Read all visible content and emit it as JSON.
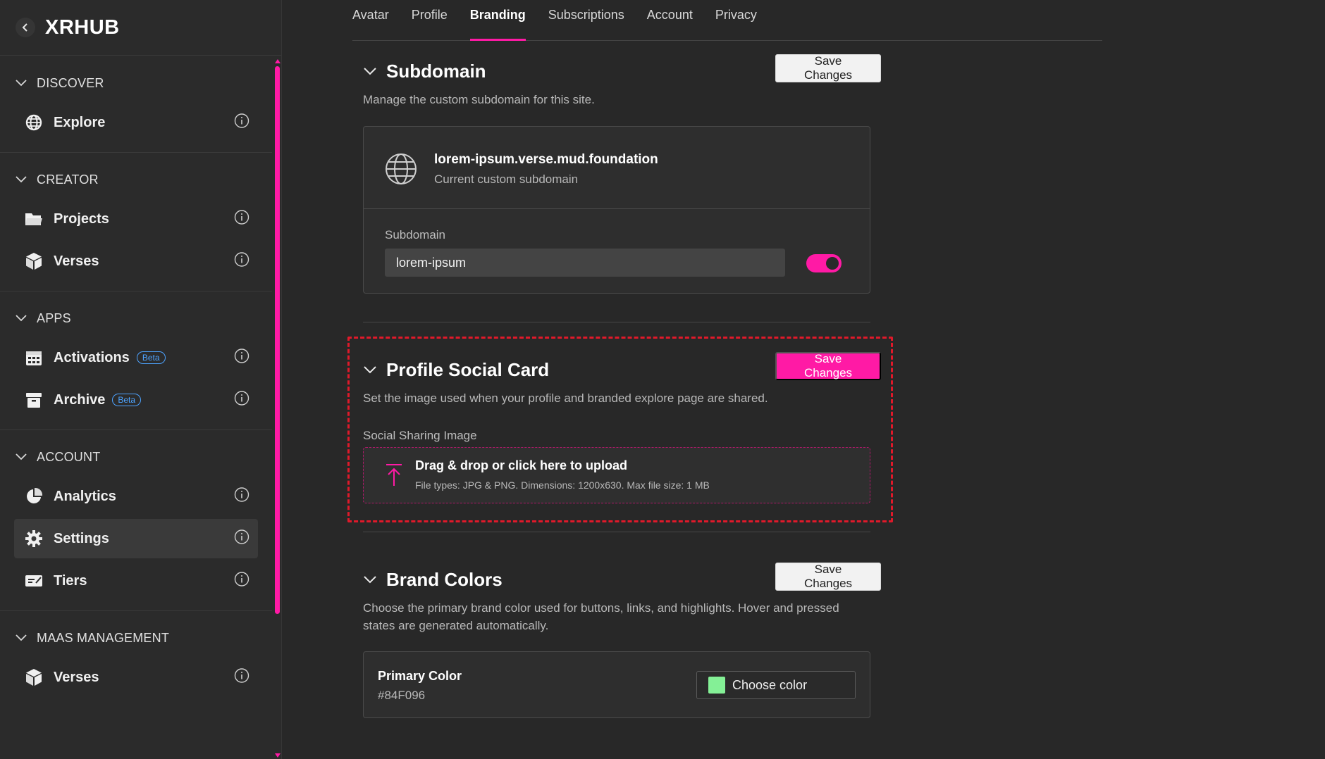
{
  "app": {
    "title": "XRHUB"
  },
  "sidebar": {
    "sections": [
      {
        "title": "DISCOVER",
        "items": [
          {
            "label": "Explore",
            "icon": "globe-icon"
          }
        ]
      },
      {
        "title": "CREATOR",
        "items": [
          {
            "label": "Projects",
            "icon": "folder-icon"
          },
          {
            "label": "Verses",
            "icon": "cube-icon"
          }
        ]
      },
      {
        "title": "APPS",
        "items": [
          {
            "label": "Activations",
            "icon": "calendar-icon",
            "badge": "Beta"
          },
          {
            "label": "Archive",
            "icon": "archive-icon",
            "badge": "Beta"
          }
        ]
      },
      {
        "title": "ACCOUNT",
        "items": [
          {
            "label": "Analytics",
            "icon": "chart-icon"
          },
          {
            "label": "Settings",
            "icon": "gear-icon",
            "active": true
          },
          {
            "label": "Tiers",
            "icon": "ticket-icon"
          }
        ]
      },
      {
        "title": "MAAS MANAGEMENT",
        "items": [
          {
            "label": "Verses",
            "icon": "cube-icon"
          }
        ]
      }
    ]
  },
  "tabs": [
    "Avatar",
    "Profile",
    "Branding",
    "Subscriptions",
    "Account",
    "Privacy"
  ],
  "active_tab": "Branding",
  "subdomain": {
    "title": "Subdomain",
    "description": "Manage the custom subdomain for this site.",
    "save_label": "Save Changes",
    "current_domain": "lorem-ipsum.verse.mud.foundation",
    "current_caption": "Current custom subdomain",
    "field_label": "Subdomain",
    "field_value": "lorem-ipsum",
    "toggle_on": true
  },
  "social_card": {
    "title": "Profile Social Card",
    "description": "Set the image used when your profile and branded explore page are shared.",
    "save_label": "Save Changes",
    "field_label": "Social Sharing Image",
    "upload_title": "Drag & drop or click here to upload",
    "upload_hint": "File types: JPG & PNG. Dimensions: 1200x630. Max file size: 1 MB"
  },
  "brand_colors": {
    "title": "Brand Colors",
    "description_line1": "Choose the primary brand color used for buttons, links, and highlights. Hover and pressed",
    "description_line2": "states are generated automatically.",
    "save_label": "Save Changes",
    "primary_label": "Primary Color",
    "primary_value": "#84F096",
    "choose_label": "Choose color"
  },
  "colors": {
    "accent": "#ff1aa5",
    "swatch": "#84F096",
    "highlight_border": "#e0192a"
  }
}
